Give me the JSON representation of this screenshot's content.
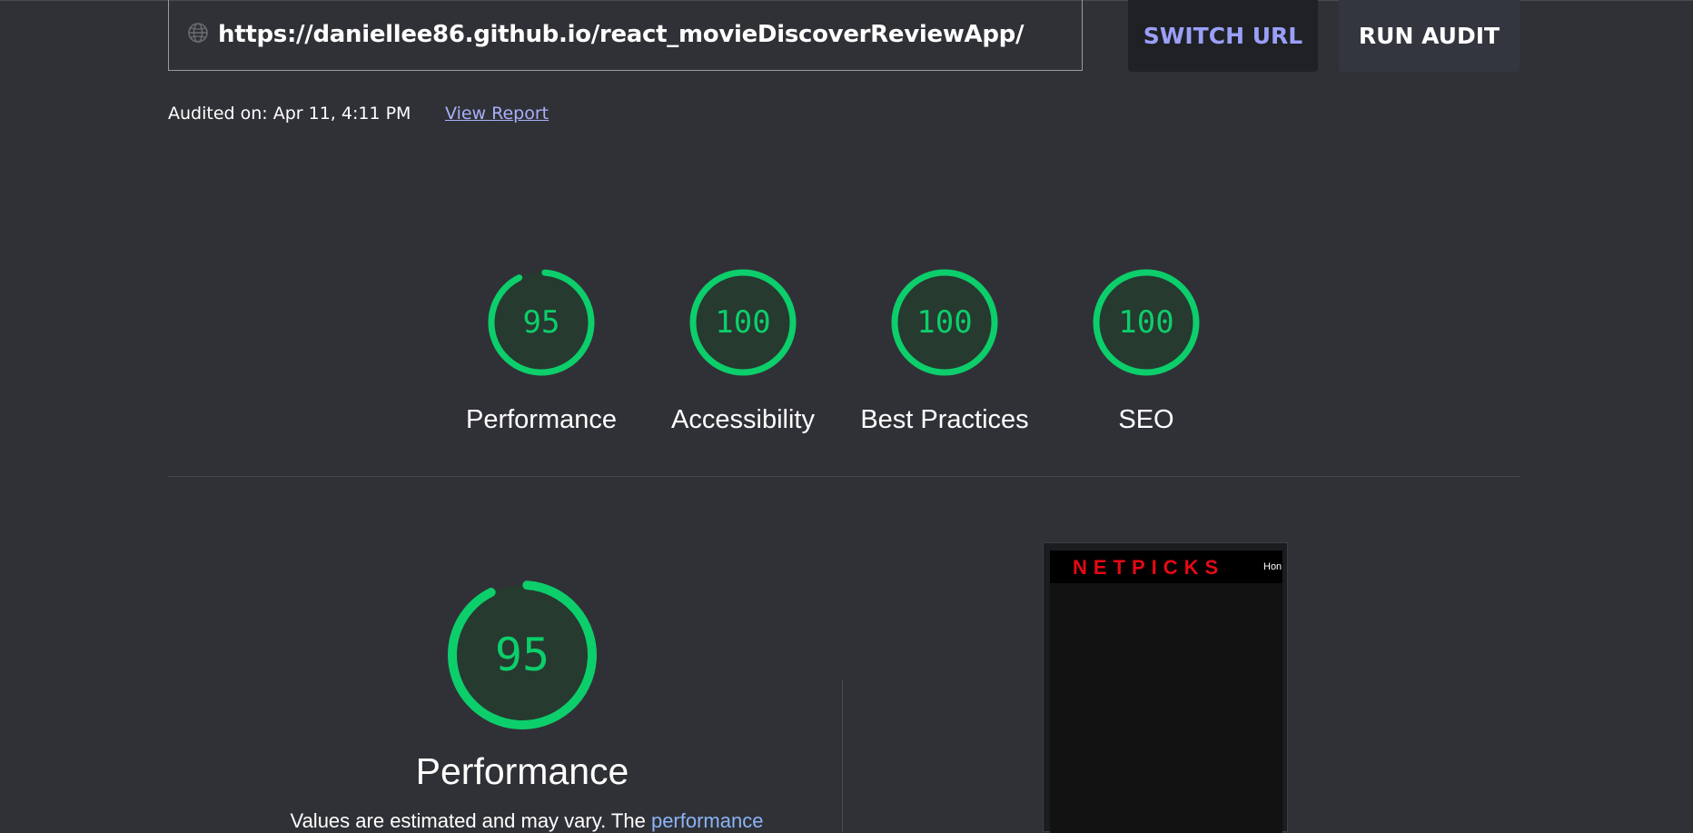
{
  "header": {
    "url": "https://daniellee86.github.io/react_movieDiscoverReviewApp/",
    "globe_icon": "globe-icon",
    "switch_url_label": "SWITCH URL",
    "run_audit_label": "RUN AUDIT"
  },
  "meta": {
    "audited_on": "Audited on: Apr 11, 4:11 PM",
    "view_report": "View Report"
  },
  "scores": [
    {
      "label": "Performance",
      "value": "95",
      "score": 0.95
    },
    {
      "label": "Accessibility",
      "value": "100",
      "score": 1.0
    },
    {
      "label": "Best Practices",
      "value": "100",
      "score": 1.0
    },
    {
      "label": "SEO",
      "value": "100",
      "score": 1.0
    }
  ],
  "detail": {
    "score": "95",
    "score_fraction": 0.95,
    "title": "Performance",
    "desc_prefix": "Values are estimated and may vary. The ",
    "desc_link": "performance"
  },
  "thumbnail": {
    "logo": "NETPICKS",
    "nav": "Hon"
  },
  "colors": {
    "pass": "#0cce6b",
    "background": "#303136",
    "link": "#8ab4f8"
  }
}
